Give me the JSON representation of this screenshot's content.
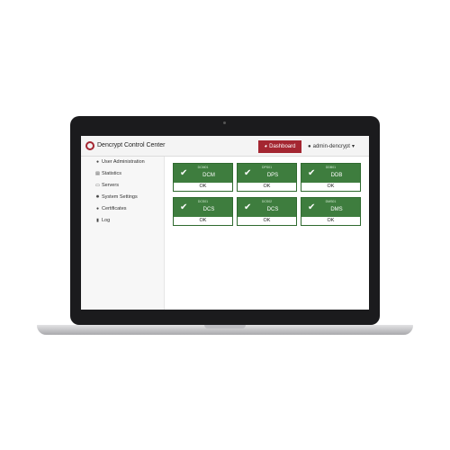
{
  "app": {
    "title": "Dencrypt Control Center",
    "accent_color": "#a42631",
    "status_color": "#3e7d3e"
  },
  "header": {
    "dashboard_label": "Dashboard",
    "dashboard_icon": "speedometer-icon",
    "user_label": "admin-dencrypt",
    "user_icon": "user-icon",
    "caret": "▾"
  },
  "sidebar": {
    "items": [
      {
        "label": "User Administration",
        "icon": "user-icon"
      },
      {
        "label": "Statistics",
        "icon": "bar-chart-icon"
      },
      {
        "label": "Servers",
        "icon": "server-icon"
      },
      {
        "label": "System Settings",
        "icon": "gear-icon"
      },
      {
        "label": "Certificates",
        "icon": "certificate-icon"
      },
      {
        "label": "Log",
        "icon": "document-icon"
      }
    ]
  },
  "tiles": [
    {
      "sub": "DCM01",
      "name": "DCM",
      "status": "OK",
      "icon": "checkmark-icon"
    },
    {
      "sub": "DPS01",
      "name": "DPS",
      "status": "OK",
      "icon": "checkmark-icon"
    },
    {
      "sub": "DDB01",
      "name": "DDB",
      "status": "OK",
      "icon": "checkmark-icon"
    },
    {
      "sub": "DCS01",
      "name": "DCS",
      "status": "OK",
      "icon": "checkmark-icon"
    },
    {
      "sub": "DCS02",
      "name": "DCS",
      "status": "OK",
      "icon": "checkmark-icon"
    },
    {
      "sub": "DMS01",
      "name": "DMS",
      "status": "OK",
      "icon": "checkmark-icon"
    }
  ]
}
